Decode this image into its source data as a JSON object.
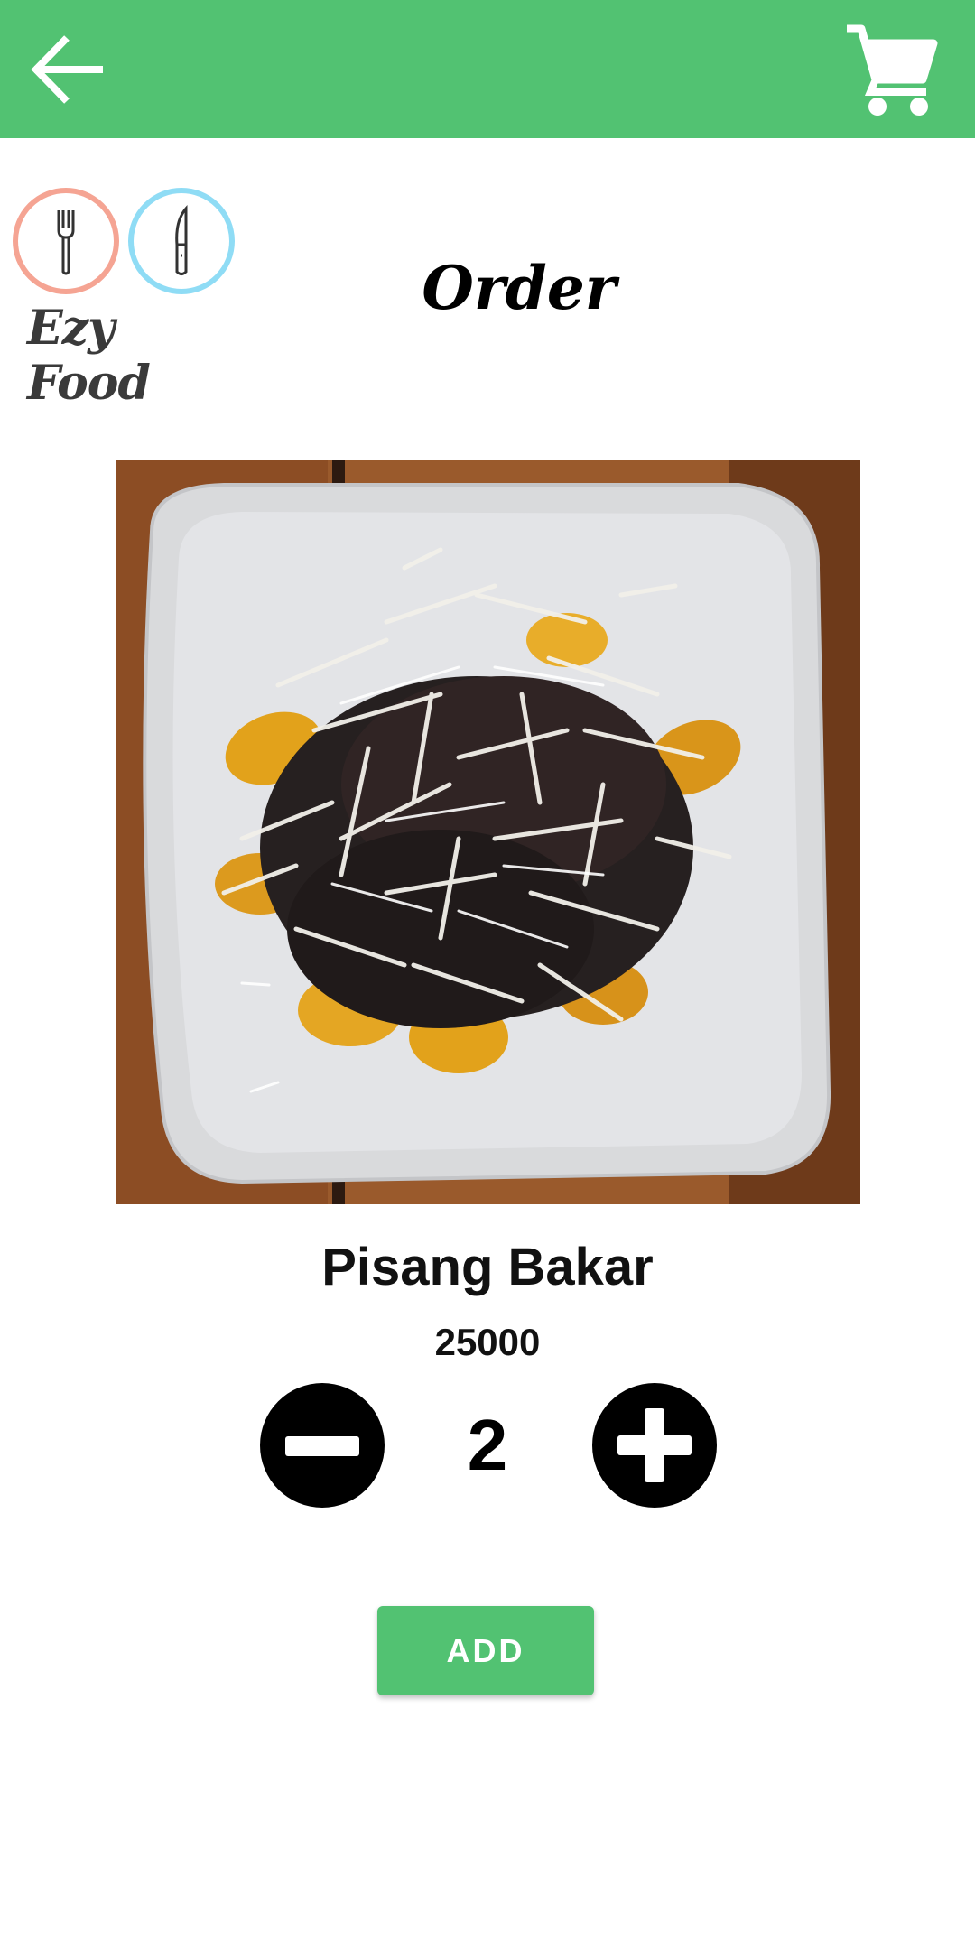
{
  "icons": {
    "back": "arrow-left-icon",
    "cart": "shopping-cart-icon",
    "fork": "fork-icon",
    "knife": "knife-icon",
    "minus": "minus-circle-icon",
    "plus": "plus-circle-icon"
  },
  "colors": {
    "appbar": "#52c272",
    "logo_ring_left": "#f5a493",
    "logo_ring_right": "#8fdcf5",
    "button": "#52c272"
  },
  "logo": {
    "text": "Ezy Food"
  },
  "page": {
    "title": "Order"
  },
  "item": {
    "name": "Pisang Bakar",
    "price": "25000",
    "quantity": "2"
  },
  "actions": {
    "add_label": "ADD"
  }
}
